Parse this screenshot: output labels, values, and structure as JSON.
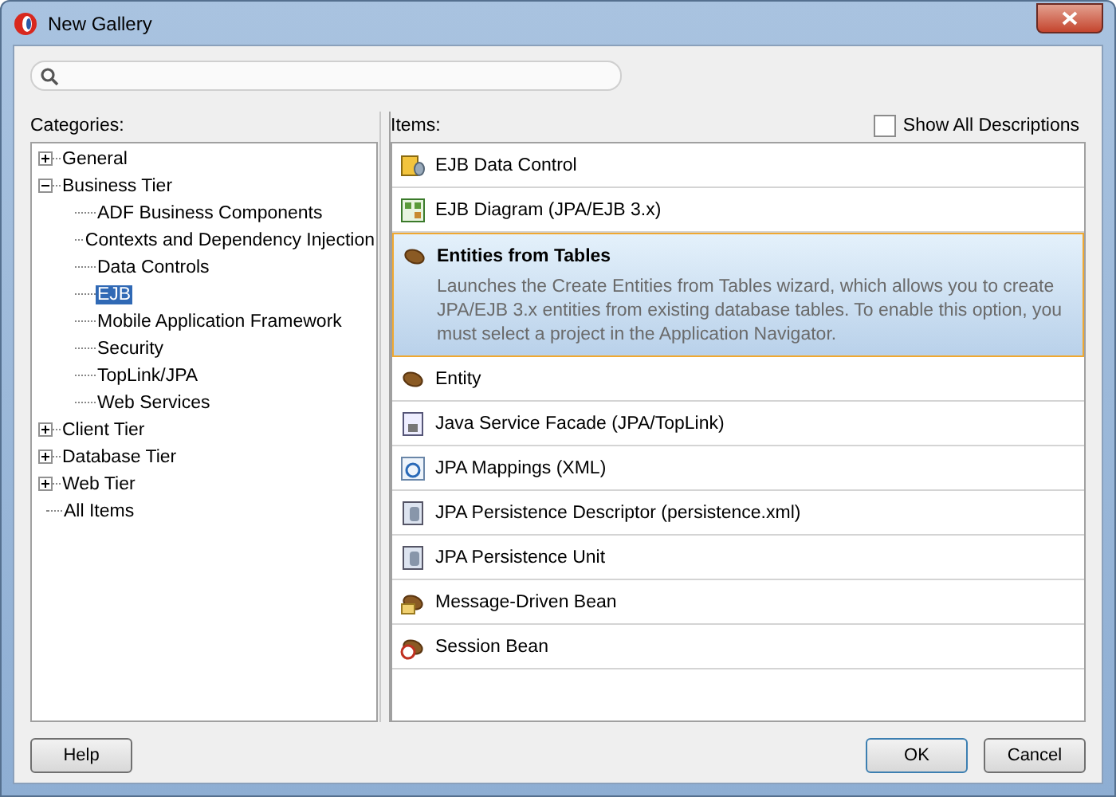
{
  "window": {
    "title": "New Gallery"
  },
  "categories": {
    "label": "Categories:",
    "tree": [
      {
        "label": "General",
        "expanded": false,
        "selected": false
      },
      {
        "label": "Business Tier",
        "expanded": true,
        "selected": false,
        "children": [
          {
            "label": "ADF Business Components",
            "selected": false
          },
          {
            "label": "Contexts and Dependency Injection",
            "selected": false
          },
          {
            "label": "Data Controls",
            "selected": false
          },
          {
            "label": "EJB",
            "selected": true
          },
          {
            "label": "Mobile Application Framework",
            "selected": false
          },
          {
            "label": "Security",
            "selected": false
          },
          {
            "label": "TopLink/JPA",
            "selected": false
          },
          {
            "label": "Web Services",
            "selected": false
          }
        ]
      },
      {
        "label": "Client Tier",
        "expanded": false,
        "selected": false
      },
      {
        "label": "Database Tier",
        "expanded": false,
        "selected": false
      },
      {
        "label": "Web Tier",
        "expanded": false,
        "selected": false
      },
      {
        "label": "All Items",
        "selected": false
      }
    ]
  },
  "items": {
    "label": "Items:",
    "show_all_descriptions": {
      "label": "Show All Descriptions",
      "checked": false
    },
    "list": [
      {
        "label": "EJB Data Control",
        "selected": false
      },
      {
        "label": "EJB Diagram (JPA/EJB 3.x)",
        "selected": false
      },
      {
        "label": "Entities from Tables",
        "selected": true,
        "description": "Launches the Create Entities from Tables wizard, which allows you to create JPA/EJB 3.x entities from existing database tables. To enable this option, you must select a project in the Application Navigator."
      },
      {
        "label": "Entity",
        "selected": false
      },
      {
        "label": "Java Service Facade (JPA/TopLink)",
        "selected": false
      },
      {
        "label": "JPA Mappings (XML)",
        "selected": false
      },
      {
        "label": "JPA Persistence Descriptor (persistence.xml)",
        "selected": false
      },
      {
        "label": "JPA Persistence Unit",
        "selected": false
      },
      {
        "label": "Message-Driven Bean",
        "selected": false
      },
      {
        "label": "Session Bean",
        "selected": false
      }
    ]
  },
  "buttons": {
    "help": "Help",
    "ok": "OK",
    "cancel": "Cancel"
  }
}
